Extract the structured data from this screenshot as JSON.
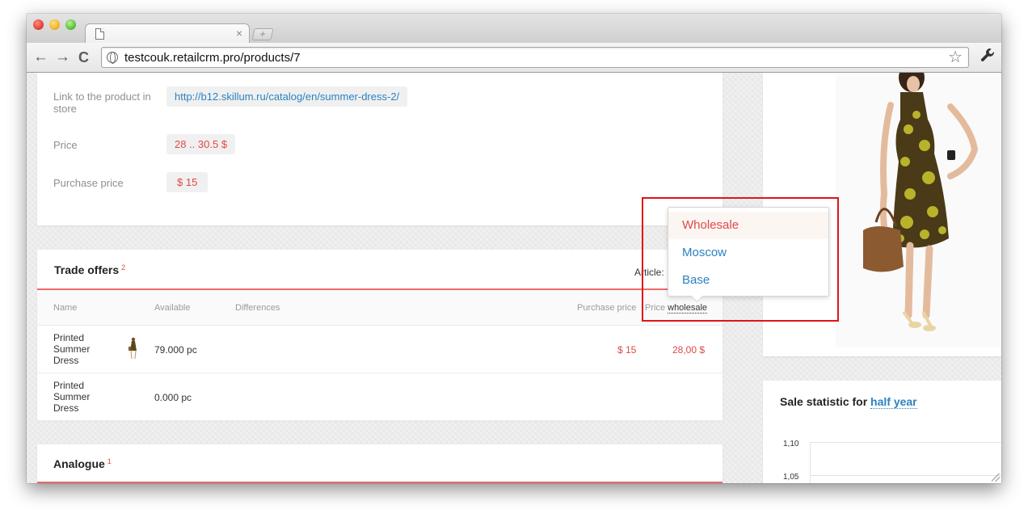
{
  "browser": {
    "tab_close": "×",
    "new_tab": "+",
    "url": "testcouk.retailcrm.pro/products/7",
    "back": "←",
    "forward": "→",
    "reload": "C",
    "star": "☆",
    "wrench": "🔧"
  },
  "product": {
    "link_label": "Link to the product in store",
    "link_value": "http://b12.skillum.ru/catalog/en/summer-dress-2/",
    "price_label": "Price",
    "price_value": "28 .. 30.5  $",
    "purchase_label": "Purchase price",
    "purchase_value": "$ 15"
  },
  "trade_offers": {
    "title": "Trade offers",
    "count": "2",
    "article": "Article:",
    "columns": {
      "name": "Name",
      "available": "Available",
      "differences": "Differences",
      "purchase_price": "Purchase price",
      "price": "Price",
      "price_type": "wholesale"
    },
    "rows": [
      {
        "name": "Printed Summer Dress",
        "available": "79.000 pc",
        "purchase": "$ 15",
        "price": "28,00 $"
      },
      {
        "name": "Printed Summer Dress",
        "available": "0.000 pc",
        "purchase": "",
        "price": ""
      }
    ]
  },
  "analogue": {
    "title": "Analogue",
    "count": "1"
  },
  "stats": {
    "title": "Sale statistic for",
    "period": "half year",
    "y_ticks": [
      "1,10",
      "1,05"
    ]
  },
  "dropdown": {
    "items": [
      {
        "label": "Wholesale",
        "active": true
      },
      {
        "label": "Moscow",
        "active": false
      },
      {
        "label": "Base",
        "active": false
      }
    ]
  },
  "colors": {
    "accent_blue": "#2b82c1",
    "accent_red": "#e04848",
    "highlight": "#e01515"
  }
}
